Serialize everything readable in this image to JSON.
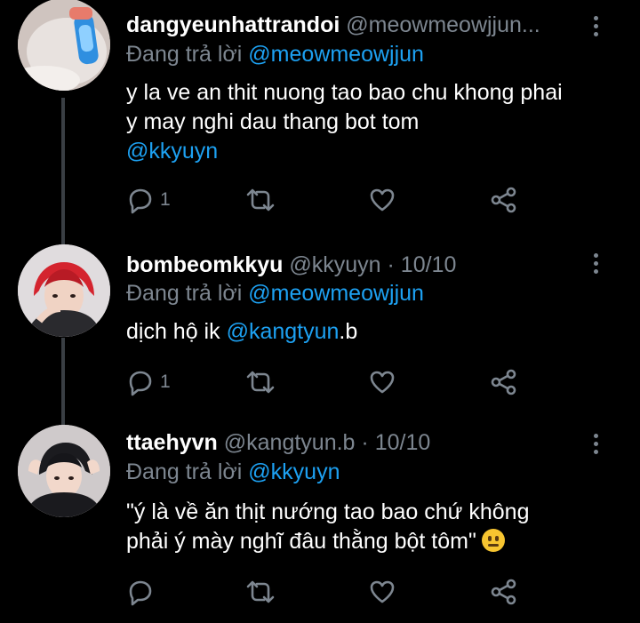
{
  "tweets": [
    {
      "name": "dangyeunhattrandoi",
      "handle": "@meowmeowjjun...",
      "date": "",
      "replying_prefix": "Đang trả lời ",
      "replying_to": "@meowmeowjjun",
      "text_parts": [
        "y la ve an thit nuong tao bao chu khong phai y may nghi dau thang bot tom"
      ],
      "mention": "@kkyuyn",
      "reply_count": "1"
    },
    {
      "name": "bombeomkkyu",
      "handle": "@kkyuyn",
      "date": "· 10/10",
      "replying_prefix": "Đang trả lời ",
      "replying_to": "@meowmeowjjun",
      "text_prefix": "dịch hộ ik ",
      "mention": "@kangtyun",
      "text_suffix": ".b",
      "reply_count": "1"
    },
    {
      "name": "ttaehyvn",
      "handle": "@kangtyun.b",
      "date": "· 10/10",
      "replying_prefix": "Đang trả lời ",
      "replying_to": "@kkyuyn",
      "text_line1": "\"ý là về ăn thịt nướng tao bao chứ không",
      "text_line2": "phải ý mày nghĩ đâu thằng bột tôm\"",
      "emoji": "neutral-face-emoji",
      "reply_count": ""
    }
  ],
  "colors": {
    "accent": "#1da1f2",
    "muted": "#7d8690",
    "background": "#000000"
  }
}
